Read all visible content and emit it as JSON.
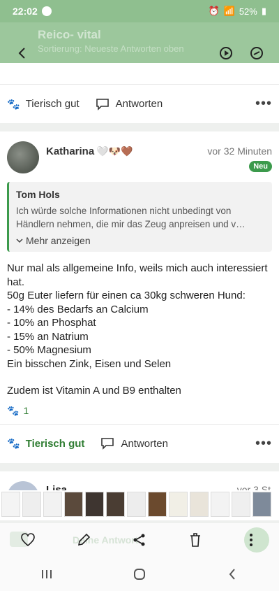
{
  "status": {
    "time": "22:02",
    "battery": "52%"
  },
  "header": {
    "title": "Reico- vital",
    "subtitle": "Sortierung: Neueste Antworten oben"
  },
  "prev_card": {
    "like_label": "Tierisch gut",
    "reply_label": "Antworten"
  },
  "post": {
    "author": "Katharina",
    "emojis": "🤍🐶🤎",
    "time": "vor 32 Minuten",
    "badge": "Neu",
    "quote": {
      "name": "Tom Hols",
      "text": "Ich würde solche Informationen nicht unbedingt von Händlern nehmen, die mir das Zeug anpreisen und v…",
      "more": "Mehr anzeigen"
    },
    "body": [
      "Nur mal als allgemeine Info, weils mich auch interessiert hat.",
      "50g Euter liefern für einen ca 30kg schweren Hund:",
      "- 14% des Bedarfs an Calcium",
      "- 10% an Phosphat",
      "- 15% an Natrium",
      "- 50% Magnesium",
      "Ein bisschen Zink, Eisen und Selen",
      "",
      "Zudem ist Vitamin A und B9 enthalten"
    ],
    "like_count": "1",
    "like_label": "Tierisch gut",
    "reply_label": "Antworten"
  },
  "next_card": {
    "author_partial": "Lisa",
    "time_partial": "vor 3 St"
  },
  "bottom_bar": {
    "faded_label": "Deine Antwort"
  },
  "colors": {
    "accent": "#2f7d32",
    "header": "#9cc79c",
    "badge": "#3c9a4c"
  }
}
